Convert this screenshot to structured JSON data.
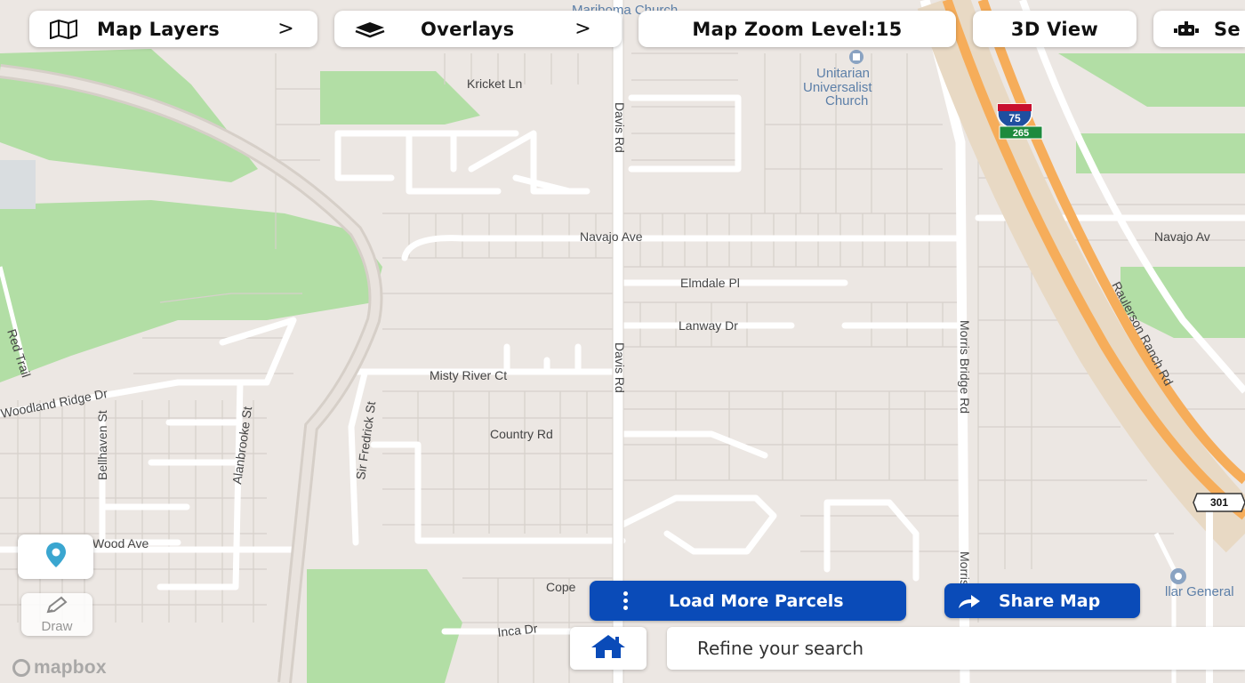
{
  "toolbar": {
    "map_layers": {
      "label": "Map Layers",
      "chevron": ">",
      "icon": "map-icon"
    },
    "overlays": {
      "label": "Overlays",
      "chevron": ">",
      "icon": "layers-icon"
    },
    "zoom": {
      "label": "Map Zoom Level:15"
    },
    "view3d": {
      "label": "3D View"
    },
    "settings": {
      "label": "Se",
      "icon": "robot-icon"
    }
  },
  "side_tools": {
    "pin": {
      "icon": "location-pin-icon"
    },
    "draw": {
      "label": "Draw",
      "icon": "pencil-icon"
    }
  },
  "actions": {
    "load_more": {
      "label": "Load More Parcels",
      "icon": "vertical-dots-icon"
    },
    "share": {
      "label": "Share Map",
      "icon": "share-arrow-icon"
    }
  },
  "search": {
    "placeholder": "Refine your search",
    "home_icon": "home-icon"
  },
  "attribution": {
    "label": "mapbox"
  },
  "map": {
    "streets": {
      "kricket": "Kricket Ln",
      "davis_top": "Davis Rd",
      "davis_mid": "Davis Rd",
      "navajo": "Navajo Ave",
      "navajo_right": "Navajo Av",
      "elmdale": "Elmdale Pl",
      "lanway": "Lanway Dr",
      "misty": "Misty River Ct",
      "country": "Country Rd",
      "woodland": "Woodland Ridge Dr",
      "bellhaven": "Bellhaven St",
      "alanbrooke": "Alanbrooke St",
      "fredrick": "Sir Fredrick St",
      "wood_ave": "Wood Ave",
      "cope": "Cope",
      "inca": "Inca Dr",
      "red_trail": "Red Trail",
      "morris_mid": "Morris Bridge Rd",
      "morris_low": "Morris",
      "raulerson": "Raulerson Ranch Rd"
    },
    "pois": {
      "church_top": "Mariboma Church",
      "unitarian_1": "Unitarian",
      "unitarian_2": "Universalist",
      "unitarian_3": "Church",
      "dollar": "llar General"
    },
    "shields": {
      "interstate": "75",
      "exit": "265",
      "us_route": "301"
    },
    "colors": {
      "land": "#ece7e3",
      "park": "#addc9f",
      "road": "#ffffff",
      "highway": "#f6ad5a",
      "water": "#aad3df",
      "accent": "#0a4bb8"
    }
  }
}
